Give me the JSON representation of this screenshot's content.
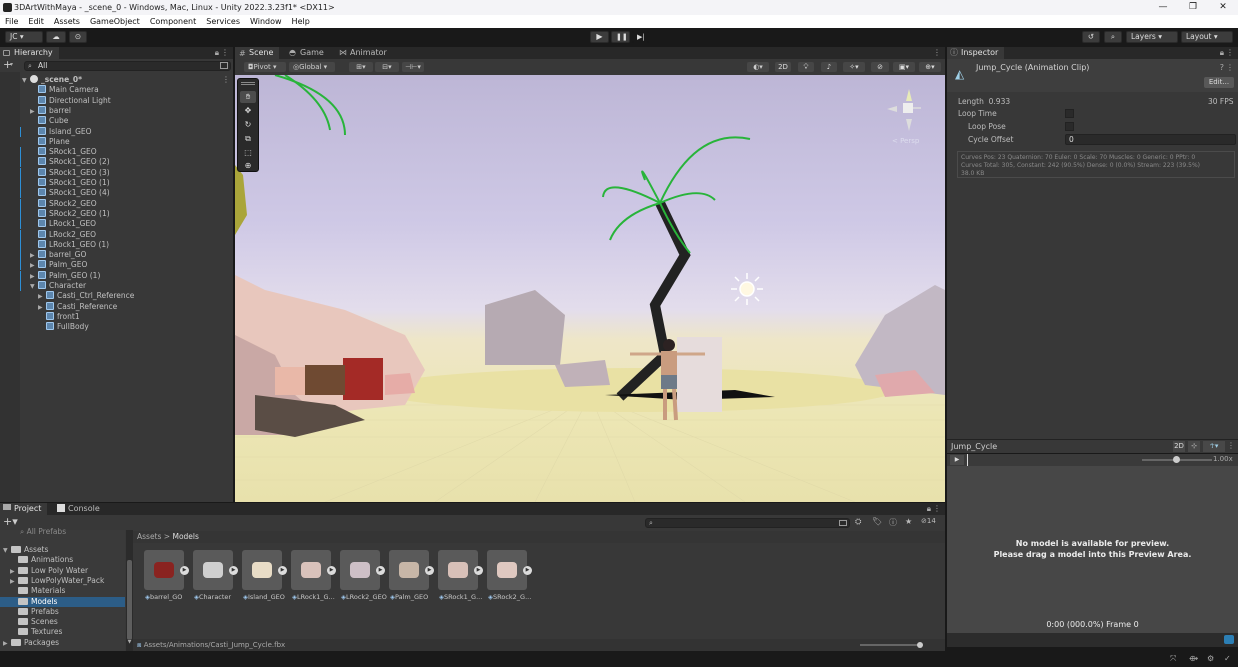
{
  "window": {
    "title": "3DArtWithMaya - _scene_0 - Windows, Mac, Linux - Unity 2022.3.23f1* <DX11>",
    "controls": [
      "—",
      "❐",
      "✕"
    ]
  },
  "menu": [
    "File",
    "Edit",
    "Assets",
    "GameObject",
    "Component",
    "Services",
    "Window",
    "Help"
  ],
  "toolbar": {
    "account": "JC ▾",
    "layers": "Layers",
    "layout": "Layout"
  },
  "hierarchy": {
    "tab": "Hierarchy",
    "search_value": "All",
    "items": [
      {
        "label": "_scene_0*",
        "depth": 0,
        "expanded": true,
        "scene": true
      },
      {
        "label": "Main Camera",
        "depth": 1
      },
      {
        "label": "Directional Light",
        "depth": 1
      },
      {
        "label": "barrel",
        "depth": 1,
        "collapsed": true
      },
      {
        "label": "Cube",
        "depth": 1
      },
      {
        "label": "Island_GEO",
        "depth": 1,
        "blue": true
      },
      {
        "label": "Plane",
        "depth": 1
      },
      {
        "label": "SRock1_GEO",
        "depth": 1,
        "blue": true
      },
      {
        "label": "SRock1_GEO (2)",
        "depth": 1,
        "blue": true
      },
      {
        "label": "SRock1_GEO (3)",
        "depth": 1,
        "blue": true
      },
      {
        "label": "SRock1_GEO (1)",
        "depth": 1,
        "blue": true
      },
      {
        "label": "SRock1_GEO (4)",
        "depth": 1,
        "blue": true
      },
      {
        "label": "SRock2_GEO",
        "depth": 1,
        "blue": true
      },
      {
        "label": "SRock2_GEO (1)",
        "depth": 1,
        "blue": true
      },
      {
        "label": "LRock1_GEO",
        "depth": 1,
        "blue": true
      },
      {
        "label": "LRock2_GEO",
        "depth": 1,
        "blue": true
      },
      {
        "label": "LRock1_GEO (1)",
        "depth": 1,
        "blue": true
      },
      {
        "label": "barrel_GO",
        "depth": 1,
        "collapsed": true,
        "blue": true
      },
      {
        "label": "Palm_GEO",
        "depth": 1,
        "collapsed": true,
        "blue": true
      },
      {
        "label": "Palm_GEO (1)",
        "depth": 1,
        "collapsed": true,
        "blue": true
      },
      {
        "label": "Character",
        "depth": 1,
        "expanded": true,
        "blue": true
      },
      {
        "label": "Casti_Ctrl_Reference",
        "depth": 2,
        "collapsed": true
      },
      {
        "label": "Casti_Reference",
        "depth": 2,
        "collapsed": true
      },
      {
        "label": "front1",
        "depth": 2
      },
      {
        "label": "FullBody",
        "depth": 2
      }
    ]
  },
  "scene": {
    "tabs": [
      "Scene",
      "Game",
      "Animator"
    ],
    "pivot": "Pivot",
    "global": "Global",
    "mode_2d": "2D",
    "persp": "< Persp"
  },
  "inspector": {
    "tab": "Inspector",
    "title": "Jump_Cycle (Animation Clip)",
    "edit_button": "Edit...",
    "length_label": "Length",
    "length_value": "0.933",
    "fps": "30 FPS",
    "loop_time": "Loop Time",
    "loop_pose": "Loop Pose",
    "cycle_offset": "Cycle Offset",
    "cycle_offset_value": "0",
    "stats_line1": "Curves Pos: 23 Quaternion: 70 Euler: 0 Scale: 70 Muscles: 0 Generic: 0 PPtr: 0",
    "stats_line2": "Curves Total: 305, Constant: 242 (90.5%) Dense: 0 (0.0%) Stream: 223 (39.5%)",
    "stats_line3": "38.0 KB"
  },
  "preview": {
    "name": "Jump_Cycle",
    "mode_2d": "2D",
    "speed": "1.00x",
    "message1": "No model is available for preview.",
    "message2": "Please drag a model into this Preview Area.",
    "time": "0:00 (000.0%) Frame 0"
  },
  "project": {
    "tabs": [
      "Project",
      "Console"
    ],
    "all_prefabs": "All Prefabs",
    "tree": [
      {
        "label": "Assets",
        "depth": 0,
        "expanded": true
      },
      {
        "label": "Animations",
        "depth": 1
      },
      {
        "label": "Low Poly Water",
        "depth": 1,
        "collapsed": true
      },
      {
        "label": "LowPolyWater_Pack",
        "depth": 1,
        "collapsed": true
      },
      {
        "label": "Materials",
        "depth": 1
      },
      {
        "label": "Models",
        "depth": 1,
        "selected": true
      },
      {
        "label": "Prefabs",
        "depth": 1
      },
      {
        "label": "Scenes",
        "depth": 1
      },
      {
        "label": "Textures",
        "depth": 1
      },
      {
        "label": "Packages",
        "depth": 0,
        "collapsed": true
      }
    ],
    "breadcrumb": [
      "Assets",
      "Models"
    ],
    "assets": [
      "barrel_GO",
      "Character",
      "Island_GEO",
      "LRock1_G...",
      "LRock2_GEO",
      "Palm_GEO",
      "SRock1_G...",
      "SRock2_G..."
    ],
    "path": "Assets/Animations/Casti_Jump_Cycle.fbx",
    "count": "14"
  },
  "colors": {
    "accent_blue": "#2c5d87",
    "selection_blue": "#2d8fd6",
    "play_bg": "#3c3c3c"
  }
}
